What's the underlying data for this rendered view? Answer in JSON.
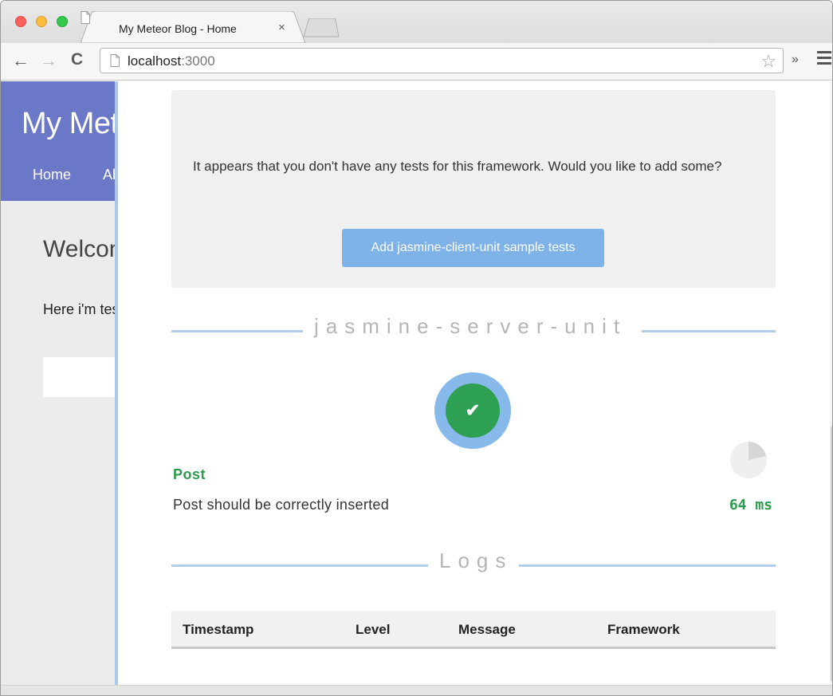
{
  "browser": {
    "tab_title": "My Meteor Blog - Home",
    "tab_close": "×",
    "url_host": "localhost",
    "url_port": ":3000",
    "ext_label": "»"
  },
  "blog": {
    "title": "My Meteor Blog",
    "nav_home": "Home",
    "nav_about": "About",
    "welcome": "Welcome",
    "intro": "Here i'm testing"
  },
  "velocity": {
    "notice_text": "It appears that you don't have any tests for this framework. Would you like to add some?",
    "add_button": "Add jasmine-client-unit sample tests",
    "framework_title": "jasmine-server-unit",
    "status_check": "✔",
    "suite": "Post",
    "test_name": "Post should be correctly inserted",
    "test_time": "64 ms",
    "logs_title": "Logs",
    "logs_columns": [
      "Timestamp",
      "Level",
      "Message",
      "Framework"
    ]
  },
  "colors": {
    "blog_header": "#6b78c8",
    "accent_blue": "#88b9eb",
    "pass_green": "#2ea053"
  }
}
